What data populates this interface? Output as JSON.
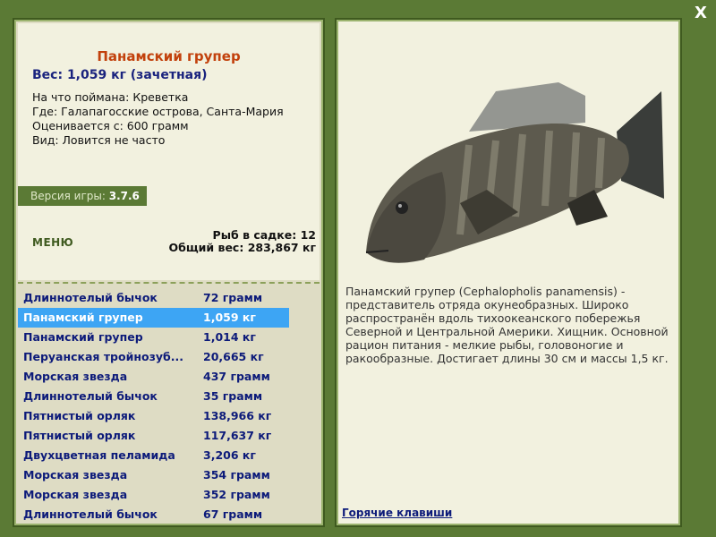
{
  "close_label": "X",
  "fish": {
    "title": "Панамский групер",
    "weight": "Вес: 1,059 кг (зачетная)",
    "caught_on": "На что поймана: Креветка",
    "where": "Где: Галапагосские острова, Санта-Мария",
    "valued_from": "Оценивается с: 600 грамм",
    "kind": "Вид: Ловится не часто"
  },
  "version": {
    "label": "Версия игры:",
    "value": "3.7.6"
  },
  "menu_label": "МЕНЮ",
  "stats": {
    "fish_in_cage": "Рыб в садке: 12",
    "total_weight": "Общий вес: 283,867 кг"
  },
  "catch_list": [
    {
      "name": "Длиннотелый бычок",
      "weight": "72 грамм"
    },
    {
      "name": "Панамский групер",
      "weight": "1,059 кг",
      "selected": true
    },
    {
      "name": "Панамский групер",
      "weight": "1,014 кг"
    },
    {
      "name": "Перуанская тройнозуб...",
      "weight": "20,665 кг"
    },
    {
      "name": "Морская звезда",
      "weight": "437 грамм"
    },
    {
      "name": "Длиннотелый бычок",
      "weight": "35 грамм"
    },
    {
      "name": "Пятнистый орляк",
      "weight": "138,966 кг"
    },
    {
      "name": "Пятнистый орляк",
      "weight": "117,637 кг"
    },
    {
      "name": "Двухцветная пеламида",
      "weight": "3,206 кг"
    },
    {
      "name": "Морская звезда",
      "weight": "354 грамм"
    },
    {
      "name": "Морская звезда",
      "weight": "352 грамм"
    },
    {
      "name": "Длиннотелый бычок",
      "weight": "67 грамм"
    }
  ],
  "description": "Панамский групер (Cephalopholis panamensis) - представитель отряда окунеобразных. Широко распространён вдоль тихоокеанского побережья Северной и Центральной Америки. Хищник. Основной рацион питания - мелкие рыбы, головоногие и ракообразные. Достигает длины 30 см и массы 1,5 кг.",
  "hotkeys_label": "Горячие клавиши",
  "colors": {
    "background": "#5b7a35",
    "panel": "#f2f1df",
    "selection": "#3da5f4",
    "title": "#c2410c",
    "list_text": "#0d1b7a"
  }
}
